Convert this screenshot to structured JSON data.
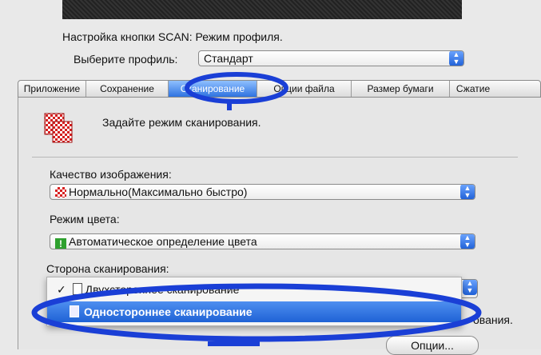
{
  "header": {
    "title": "Настройка кнопки SCAN: Режим профиля.",
    "profile_label": "Выберите профиль:",
    "profile_value": "Стандарт"
  },
  "tabs": [
    {
      "label": "Приложение"
    },
    {
      "label": "Сохранение"
    },
    {
      "label": "Сканирование",
      "active": true
    },
    {
      "label": "Опции файла"
    },
    {
      "label": "Размер бумаги"
    },
    {
      "label": "Сжатие"
    }
  ],
  "panel": {
    "instruction": "Задайте режим сканирования.",
    "quality_label": "Качество изображения:",
    "quality_value": "Нормально(Максимально быстро)",
    "color_label": "Режим цвета:",
    "color_value": "Автоматическое определение цвета",
    "side_label": "Сторона сканирования:",
    "side_menu": {
      "items": [
        {
          "label": "Двухстороннее сканирование",
          "checked": true
        },
        {
          "label": "Одностороннее сканирование",
          "selected": true
        }
      ]
    },
    "tail_text": "ования.",
    "options_button": "Опции..."
  },
  "colors": {
    "accent_blue": "#1f62d6",
    "annotation_blue": "#1a3fd6",
    "quality_icon_red": "#d82020",
    "color_icon_green": "#2ea02e"
  },
  "icons": {
    "scan_icon": "checker-pages-icon",
    "quality_icon": "red-checker-icon",
    "color_icon": "green-exclamation-icon",
    "duplex_icon": "duplex-page-icon",
    "simplex_icon": "simplex-page-icon"
  }
}
